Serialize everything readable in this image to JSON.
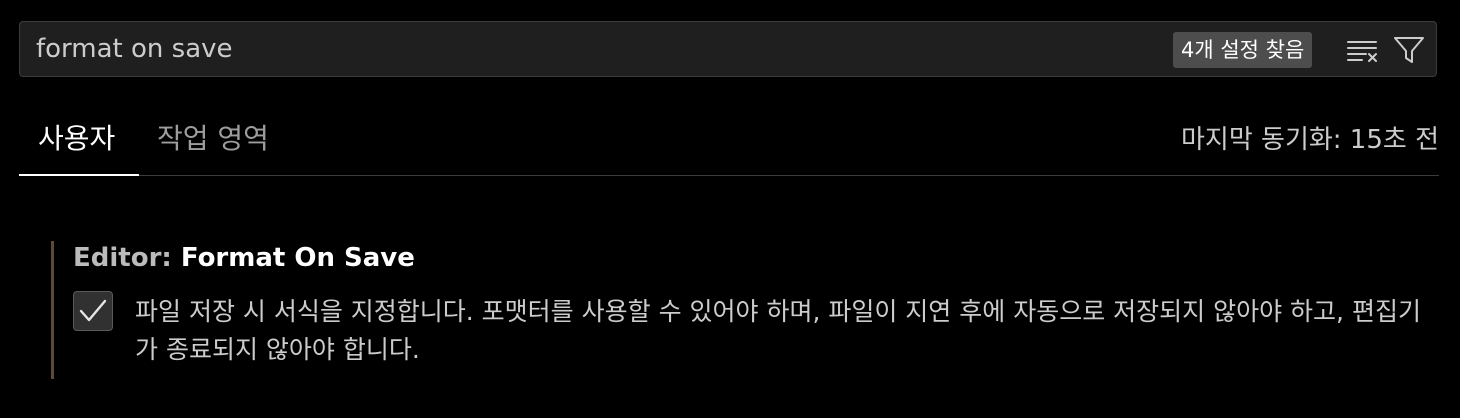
{
  "search": {
    "value": "format on save",
    "results_badge": "4개 설정 찾음",
    "clear_icon": "clear-filter-icon",
    "filter_icon": "filter-icon"
  },
  "tabs": [
    {
      "label": "사용자",
      "active": true
    },
    {
      "label": "작업 영역",
      "active": false
    }
  ],
  "sync_status": "마지막 동기화: 15초 전",
  "setting": {
    "category": "Editor: ",
    "name": "Format On Save",
    "checked": true,
    "description": "파일 저장 시 서식을 지정합니다. 포맷터를 사용할 수 있어야 하며, 파일이 지연 후에 자동으로 저장되지 않아야 하고, 편집기가 종료되지 않아야 합니다."
  },
  "colors": {
    "background": "#000000",
    "search_bg": "#1f1f1f",
    "badge_bg": "#4d4d4d",
    "modified_indicator": "#5b4a34"
  }
}
